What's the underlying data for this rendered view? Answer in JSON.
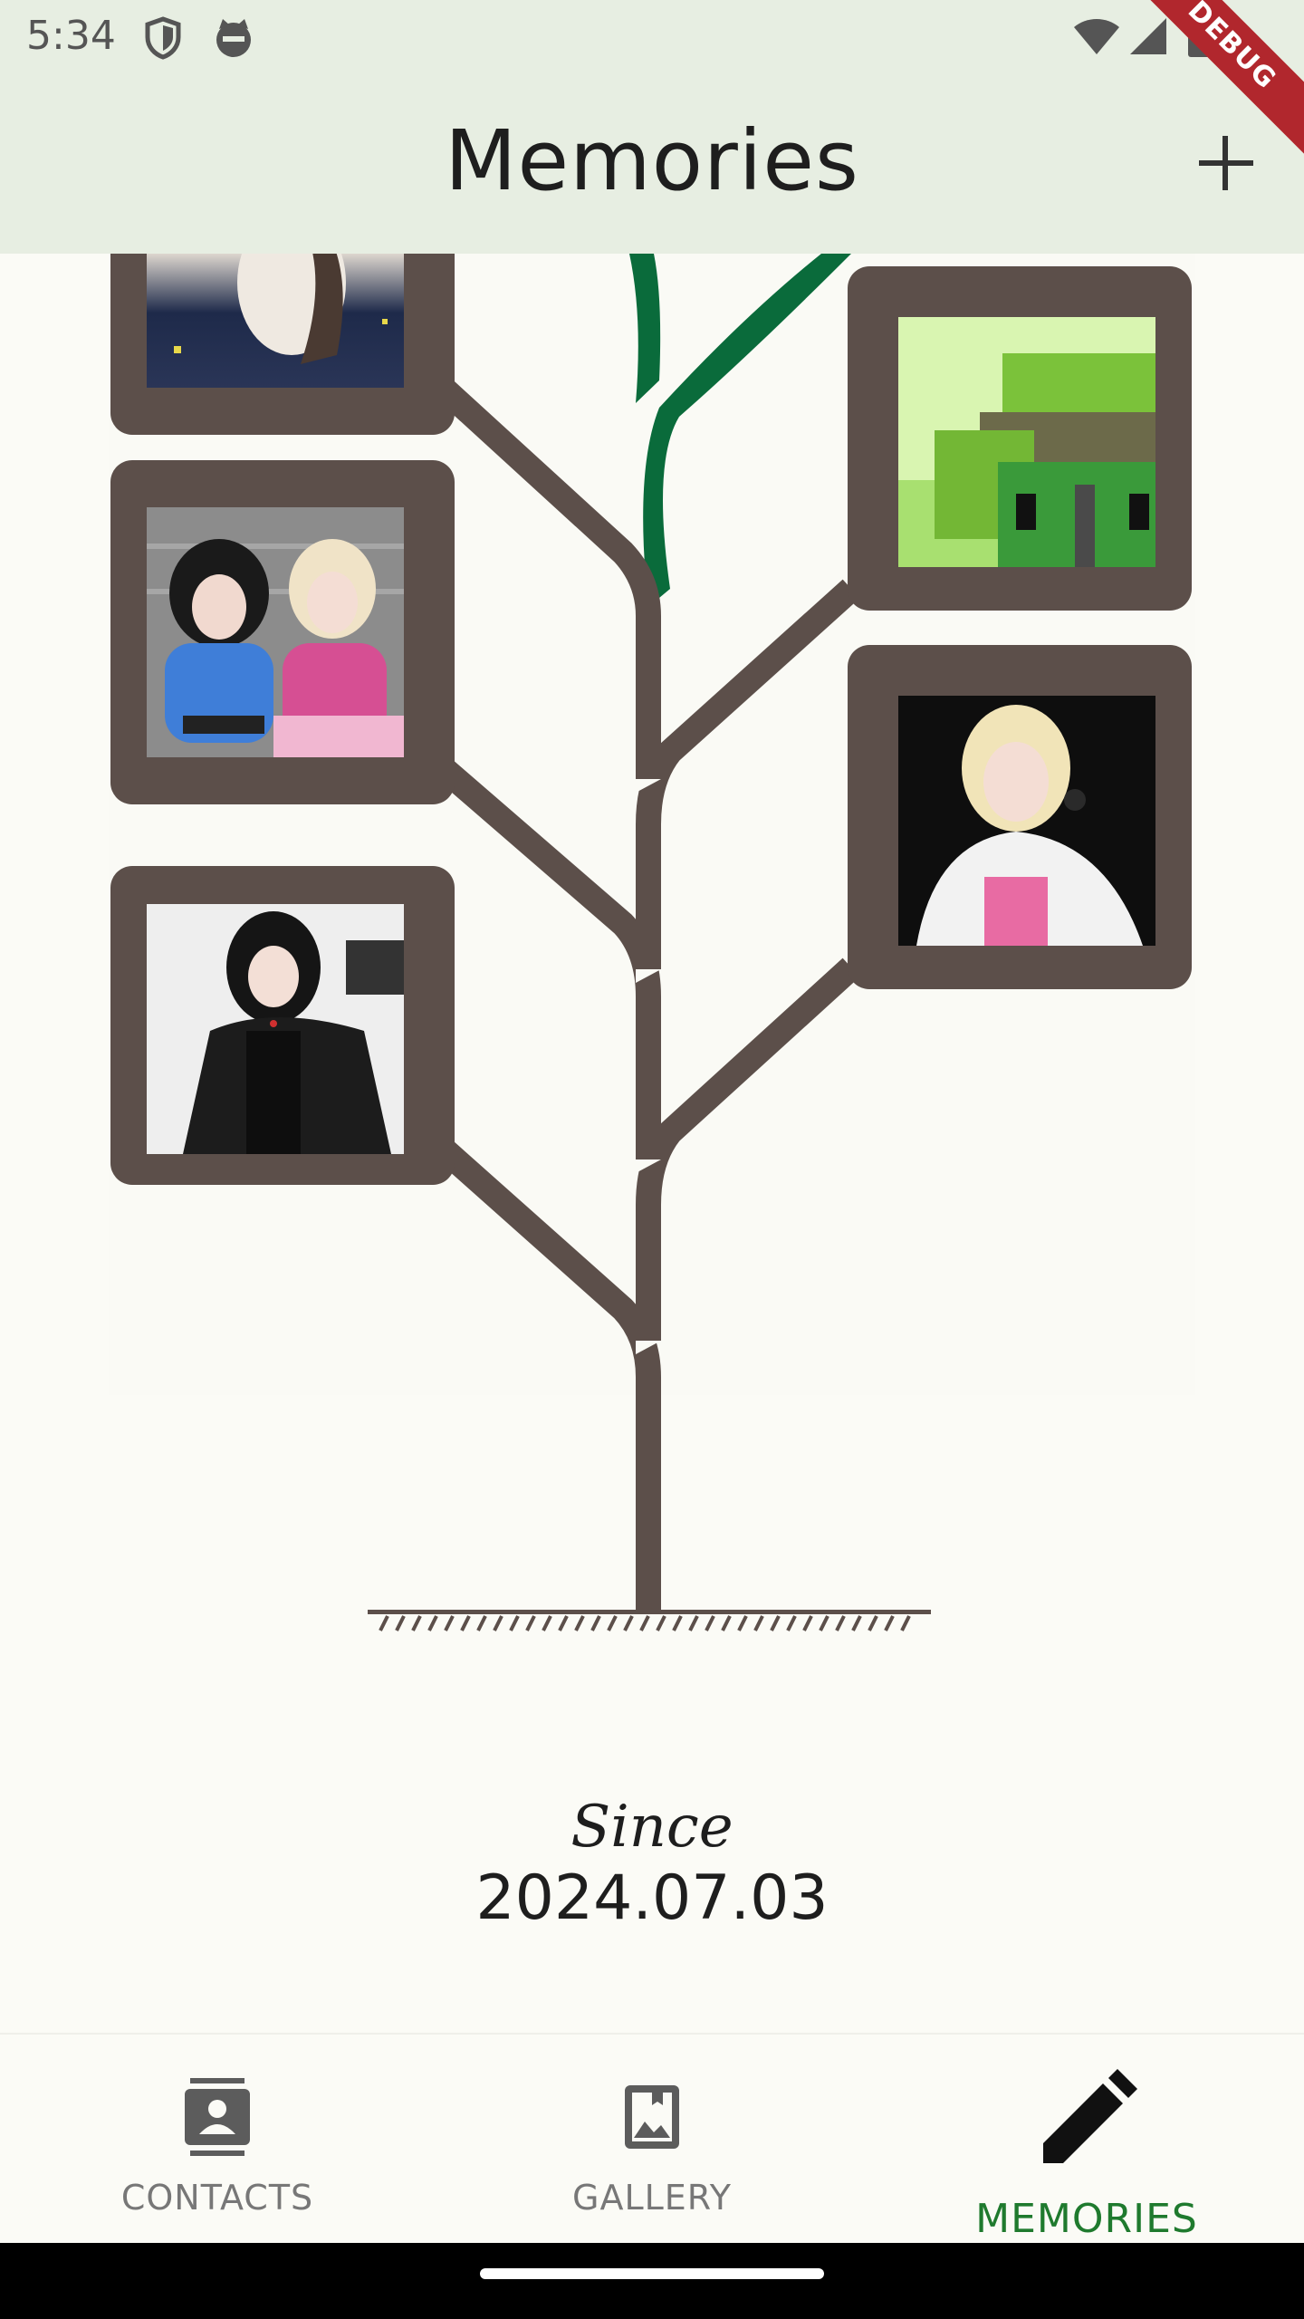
{
  "status_bar": {
    "time": "5:34",
    "icons": [
      "shield-icon",
      "cat-face-icon",
      "wifi-icon",
      "signal-icon",
      "battery-icon"
    ]
  },
  "app_bar": {
    "title": "Memories",
    "add_icon": "plus-icon",
    "debug_banner": "DEBUG"
  },
  "tree": {
    "photos": [
      {
        "name": "photo-top-left",
        "description_icon": "photo-icon"
      },
      {
        "name": "photo-middle-left",
        "description_icon": "photo-icon"
      },
      {
        "name": "photo-bottom-left",
        "description_icon": "photo-icon"
      },
      {
        "name": "photo-top-right",
        "description_icon": "photo-icon"
      },
      {
        "name": "photo-middle-right",
        "description_icon": "photo-icon"
      }
    ],
    "colors": {
      "trunk": "#5c4f4a",
      "sprout": "#0a6b3b",
      "frame": "#5c4f4a"
    }
  },
  "since": {
    "label": "Since",
    "date": "2024.07.03"
  },
  "bottom_nav": {
    "items": [
      {
        "label": "CONTACTS",
        "icon": "contact-card-icon",
        "active": false
      },
      {
        "label": "GALLERY",
        "icon": "photo-album-icon",
        "active": false
      },
      {
        "label": "MEMORIES",
        "icon": "pencil-icon",
        "active": true
      }
    ],
    "active_color": "#1f7a2e"
  }
}
